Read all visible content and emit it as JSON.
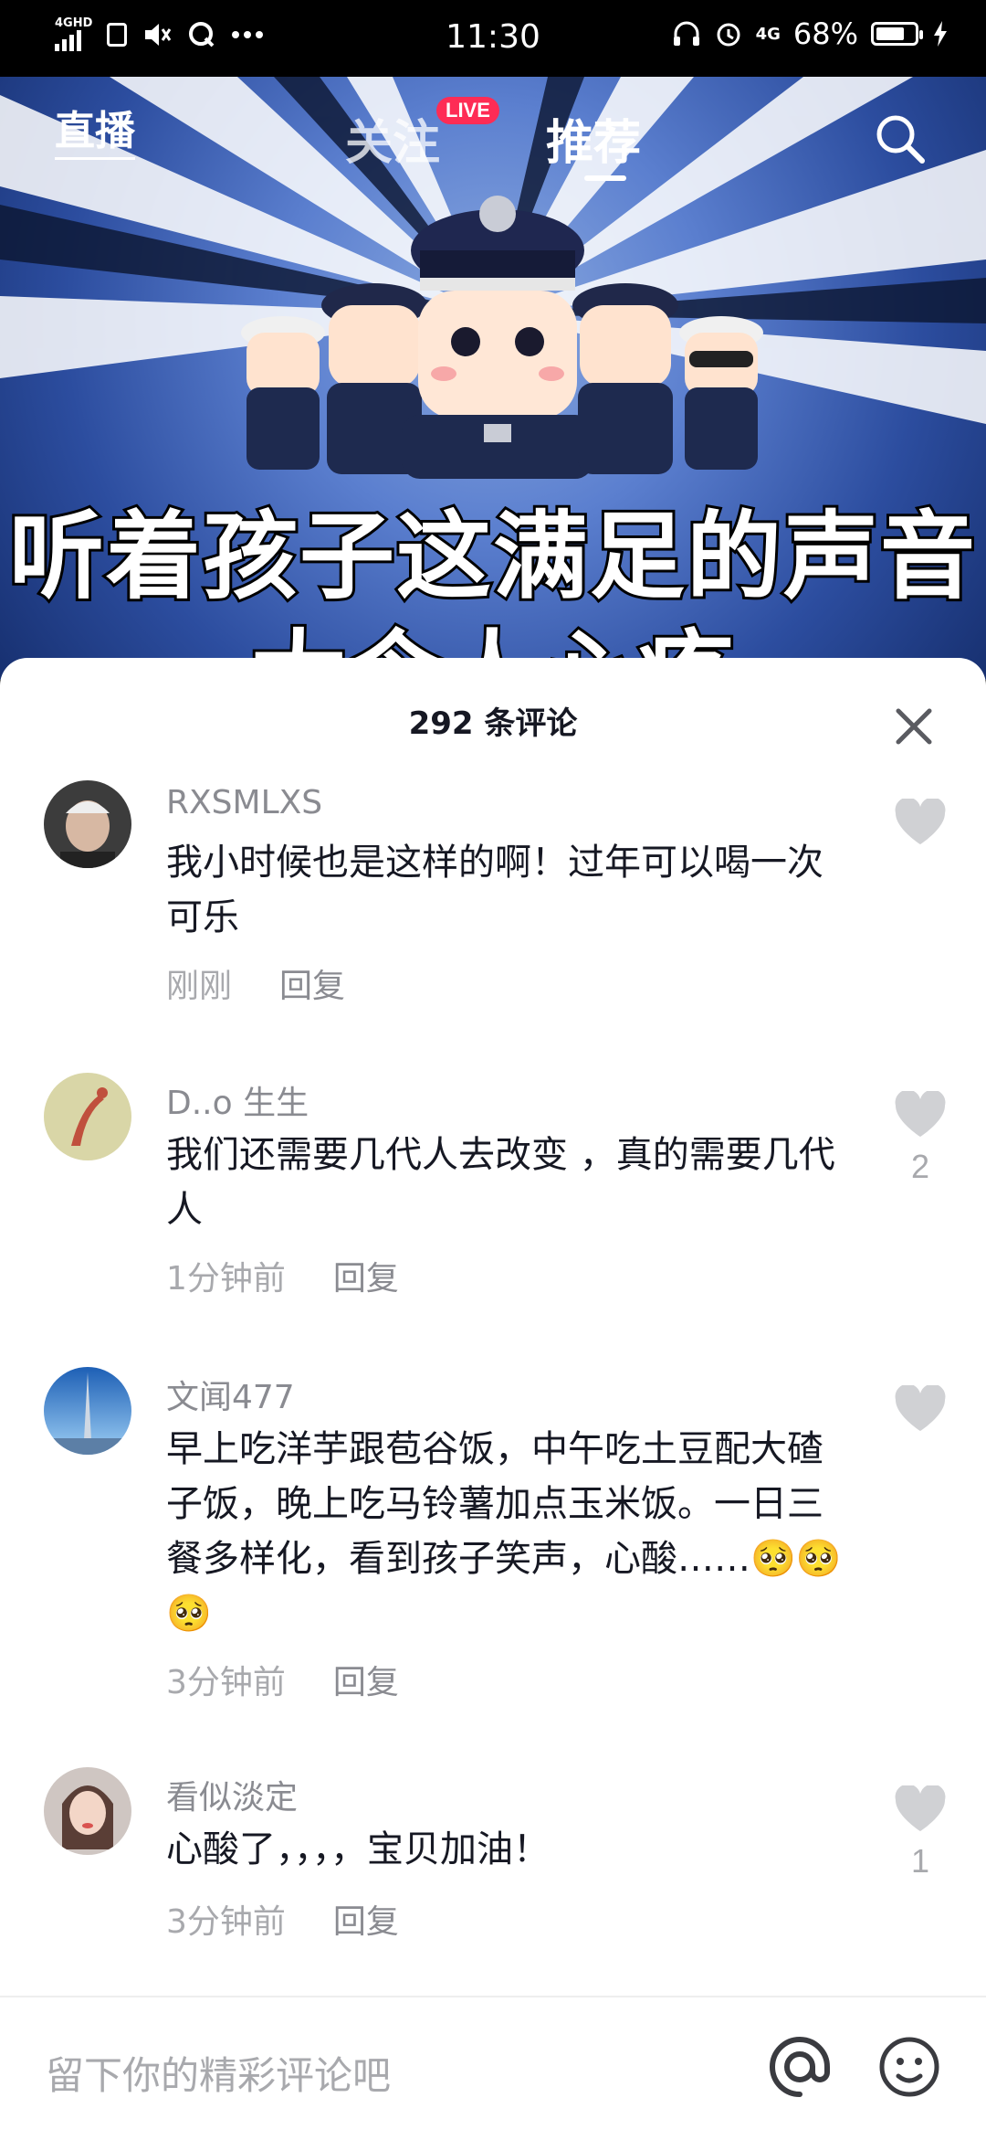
{
  "status_bar": {
    "network": "4GHD",
    "time": "11:30",
    "signal_type": "4G",
    "battery": "68%",
    "icons": [
      "signal-icon",
      "sim-icon",
      "mute-icon",
      "q-app-icon",
      "more-dots-icon",
      "headphones-icon",
      "alarm-icon",
      "battery-icon",
      "charging-icon"
    ]
  },
  "top_nav": {
    "live": "直播",
    "follow": "关注",
    "live_badge": "LIVE",
    "recommend": "推荐"
  },
  "video": {
    "caption_line1": "听着孩子这满足的声音",
    "caption_line2": "太令人心疼"
  },
  "comments_sheet": {
    "title": "292 条评论",
    "comments": [
      {
        "user": "RXSMLXS",
        "text": "我小时候也是这样的啊！过年可以喝一次可乐",
        "time": "刚刚",
        "reply": "回复",
        "likes": ""
      },
      {
        "user": "D..o 生生",
        "text": "我们还需要几代人去改变 ，真的需要几代人",
        "time": "1分钟前",
        "reply": "回复",
        "likes": "2"
      },
      {
        "user": "文闻477",
        "text": "早上吃洋芋跟苞谷饭，中午吃土豆配大碴子饭，晚上吃马铃薯加点玉米饭。一日三餐多样化，看到孩子笑声，心酸……🥺🥺🥺",
        "time": "3分钟前",
        "reply": "回复",
        "likes": ""
      },
      {
        "user": "看似淡定",
        "text": "心酸了，，，，宝贝加油！",
        "time": "3分钟前",
        "reply": "回复",
        "likes": "1"
      }
    ]
  },
  "input": {
    "placeholder": "留下你的精彩评论吧"
  },
  "colors": {
    "accent": "#fe2c55",
    "text": "#161823",
    "muted": "#a8a9ad"
  }
}
